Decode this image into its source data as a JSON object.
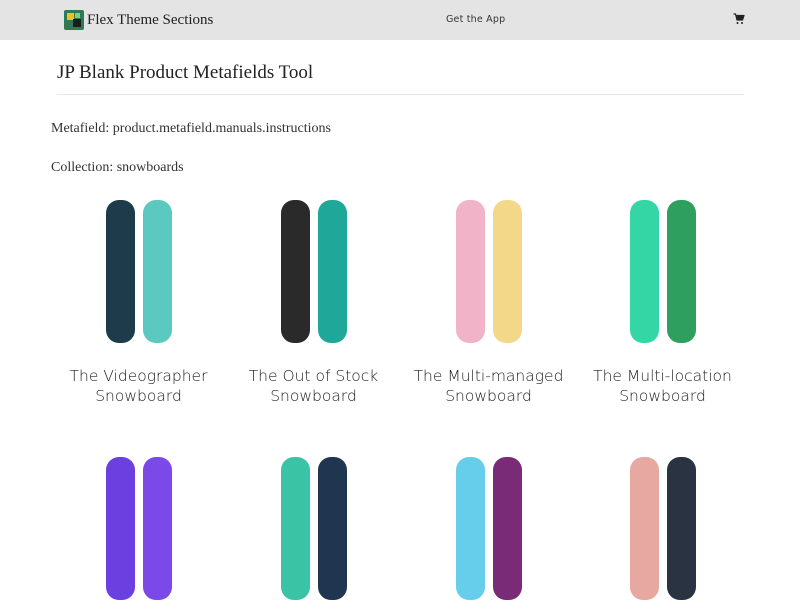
{
  "header": {
    "brand_name": "Flex Theme Sections",
    "get_app_label": "Get the App",
    "cart_icon": "cart-icon"
  },
  "main": {
    "title": "JP Blank Product Metafields Tool",
    "metafield_text": "Metafield: product.metafield.manuals.instructions",
    "collection_text": "Collection: snowboards"
  },
  "products": [
    {
      "title": "The Videographer Snowboard",
      "colors": [
        "#1d3b4a",
        "#5cc9c0"
      ]
    },
    {
      "title": "The Out of Stock Snowboard",
      "colors": [
        "#2a2a2a",
        "#1fa89a"
      ]
    },
    {
      "title": "The Multi-managed Snowboard",
      "colors": [
        "#f0b3c8",
        "#f3d889"
      ]
    },
    {
      "title": "The Multi-location Snowboard",
      "colors": [
        "#35d6a6",
        "#2e9f5e"
      ]
    },
    {
      "title": "",
      "colors": [
        "#6b3fe0",
        "#7a49e8"
      ]
    },
    {
      "title": "",
      "colors": [
        "#3bc3a6",
        "#20354f"
      ]
    },
    {
      "title": "",
      "colors": [
        "#66cdea",
        "#7a2b78"
      ]
    },
    {
      "title": "",
      "colors": [
        "#e6a8a0",
        "#2a3342"
      ]
    }
  ]
}
